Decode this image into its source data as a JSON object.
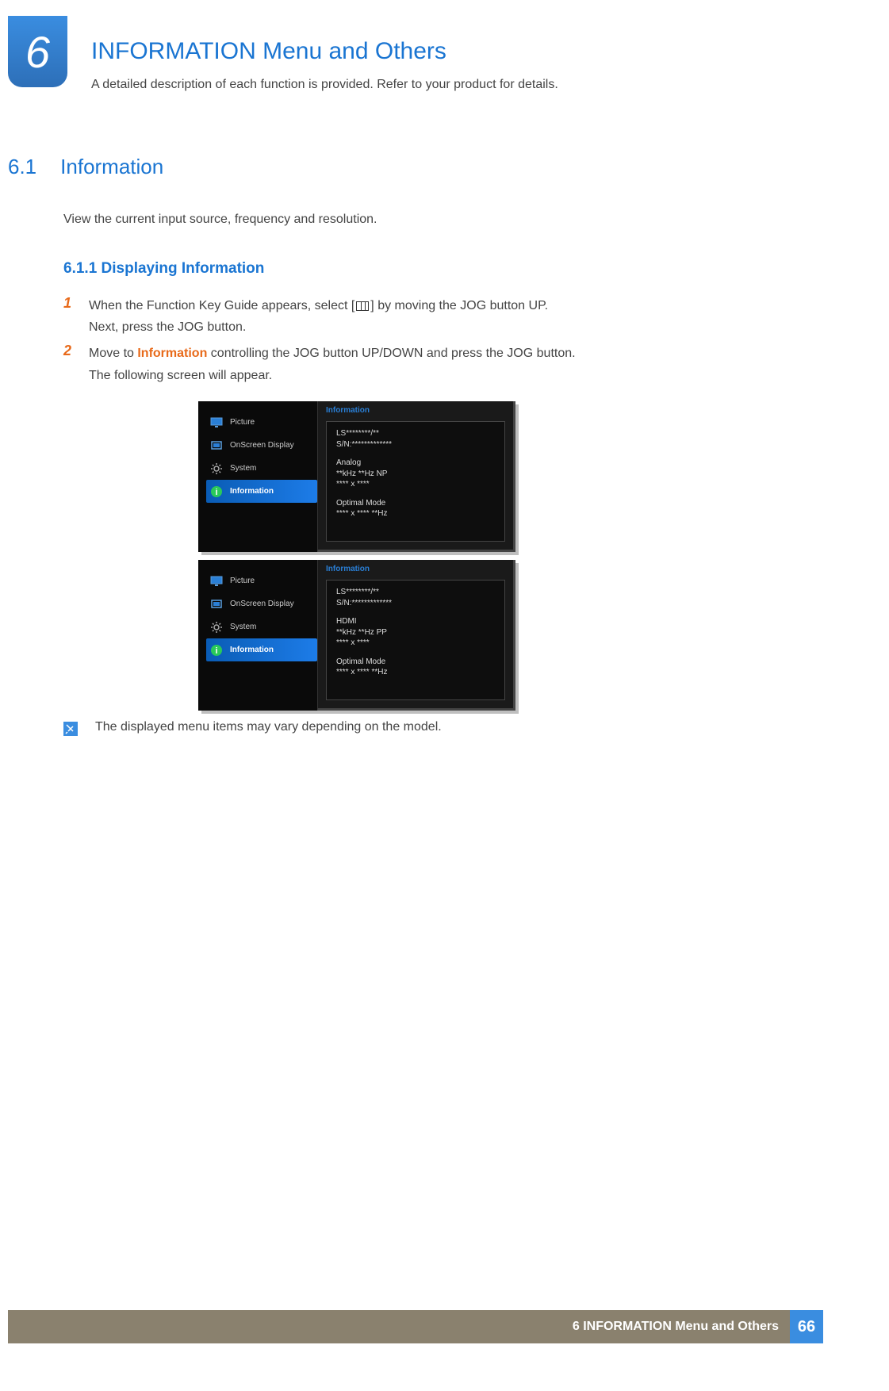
{
  "chapter": {
    "number": "6",
    "title": "INFORMATION Menu and Others",
    "subtitle": "A detailed description of each function is provided. Refer to your product for details."
  },
  "section": {
    "number": "6.1",
    "title": "Information",
    "desc": "View the current input source, frequency and resolution."
  },
  "subsection": {
    "header": "6.1.1    Displaying Information"
  },
  "steps": {
    "s1": {
      "num": "1",
      "text_a": "When the Function Key Guide appears, select [",
      "text_b": "] by moving the JOG button UP.",
      "text_c": "Next, press the JOG button."
    },
    "s2": {
      "num": "2",
      "text_a": "Move to ",
      "highlight": "Information",
      "text_b": " controlling the JOG button UP/DOWN and press the JOG button.",
      "text_c": "The following screen will appear."
    }
  },
  "osd": {
    "menu": {
      "picture": "Picture",
      "onscreen": "OnScreen Display",
      "system": "System",
      "information": "Information"
    },
    "panel_title": "Information",
    "screen1": {
      "l1": "LS********/**",
      "l2": "S/N:*************",
      "l3": "Analog",
      "l4": "**kHz **Hz NP",
      "l5": "**** x ****",
      "l6": "Optimal Mode",
      "l7": "**** x **** **Hz"
    },
    "screen2": {
      "l1": "LS********/**",
      "l2": "S/N:*************",
      "l3": "HDMI",
      "l4": "**kHz **Hz PP",
      "l5": "**** x ****",
      "l6": "Optimal Mode",
      "l7": "**** x **** **Hz"
    }
  },
  "note": {
    "text": "The displayed menu items may vary depending on the model."
  },
  "footer": {
    "text": "6 INFORMATION Menu and Others",
    "page": "66"
  }
}
